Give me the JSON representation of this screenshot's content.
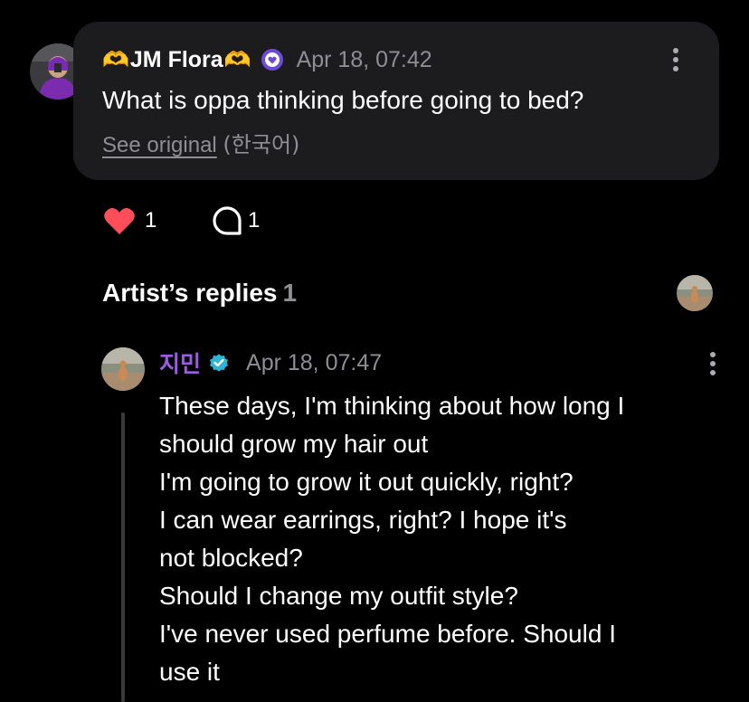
{
  "post": {
    "user_name_prefix_emoji": "🫶",
    "user_name": "JM Flora",
    "user_name_suffix_emoji": "🫶",
    "timestamp": "Apr 18, 07:42",
    "text": "What is oppa thinking before going to bed?",
    "see_original_label": "See original",
    "original_language": "(한국어)",
    "likes_count": "1",
    "comments_count": "1"
  },
  "artist_replies": {
    "title": "Artist’s replies",
    "count": "1"
  },
  "reply": {
    "author_name": "지민",
    "timestamp": "Apr 18, 07:47",
    "lines": [
      "These days, I'm thinking about how long I",
      "should grow my hair out",
      "I'm going to grow it out quickly, right?",
      "I can wear earrings, right? I hope it's",
      "not blocked?",
      "Should I change my outfit style?",
      "I've never used perfume before. Should I",
      "use it"
    ]
  },
  "colors": {
    "background": "#000000",
    "card": "#1c1c1e",
    "muted_text": "#8e8e93",
    "heart": "#ff4d5a",
    "artist_name": "#9d5ce6",
    "verified_badge": "#2fb3d6",
    "membership_badge": "#6c4bd8"
  },
  "icons": {
    "more": "more-vertical-icon",
    "like": "heart-icon",
    "comment": "comment-bubble-icon",
    "verified": "verified-check-icon",
    "membership": "membership-heart-badge-icon"
  }
}
